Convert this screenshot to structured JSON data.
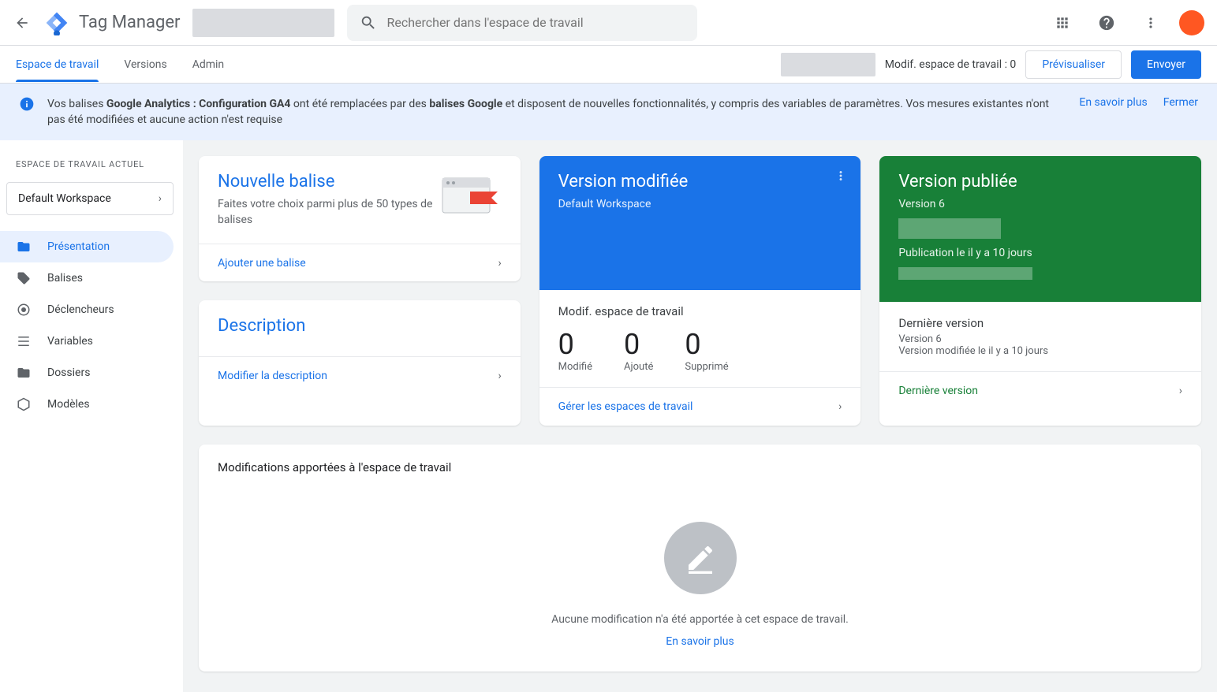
{
  "header": {
    "title": "Tag Manager",
    "search_placeholder": "Rechercher dans l'espace de travail"
  },
  "tabs": {
    "workspace": "Espace de travail",
    "versions": "Versions",
    "admin": "Admin"
  },
  "subheader": {
    "mods_label": "Modif. espace de travail : 0",
    "preview": "Prévisualiser",
    "submit": "Envoyer"
  },
  "banner": {
    "text_prefix": "Vos balises ",
    "bold1": "Google Analytics : Configuration GA4",
    "text_mid": " ont été remplacées par des ",
    "bold2": "balises Google",
    "text_suffix": " et disposent de nouvelles fonctionnalités, y compris des variables de paramètres. Vos mesures existantes n'ont pas été modifiées et aucune action n'est requise",
    "learn_more": "En savoir plus",
    "close": "Fermer"
  },
  "sidebar": {
    "current_label": "ESPACE DE TRAVAIL ACTUEL",
    "workspace_name": "Default Workspace",
    "items": [
      {
        "label": "Présentation"
      },
      {
        "label": "Balises"
      },
      {
        "label": "Déclencheurs"
      },
      {
        "label": "Variables"
      },
      {
        "label": "Dossiers"
      },
      {
        "label": "Modèles"
      }
    ]
  },
  "card_new_tag": {
    "title": "Nouvelle balise",
    "sub": "Faites votre choix parmi plus de 50 types de balises",
    "action": "Ajouter une balise"
  },
  "card_description": {
    "title": "Description",
    "action": "Modifier la description"
  },
  "card_modified": {
    "title": "Version modifiée",
    "sub": "Default Workspace",
    "stats_title": "Modif. espace de travail",
    "stat1_val": "0",
    "stat1_label": "Modifié",
    "stat2_val": "0",
    "stat2_label": "Ajouté",
    "stat3_val": "0",
    "stat3_label": "Supprimé",
    "action": "Gérer les espaces de travail"
  },
  "card_published": {
    "title": "Version publiée",
    "sub": "Version 6",
    "pub_line": "Publication le il y a 10 jours",
    "latest_title": "Dernière version",
    "latest_ver": "Version 6",
    "latest_sub": "Version modifiée le il y a 10 jours",
    "action": "Dernière version"
  },
  "workspace_changes": {
    "title": "Modifications apportées à l'espace de travail",
    "empty": "Aucune modification n'a été apportée à cet espace de travail.",
    "learn_more": "En savoir plus"
  }
}
